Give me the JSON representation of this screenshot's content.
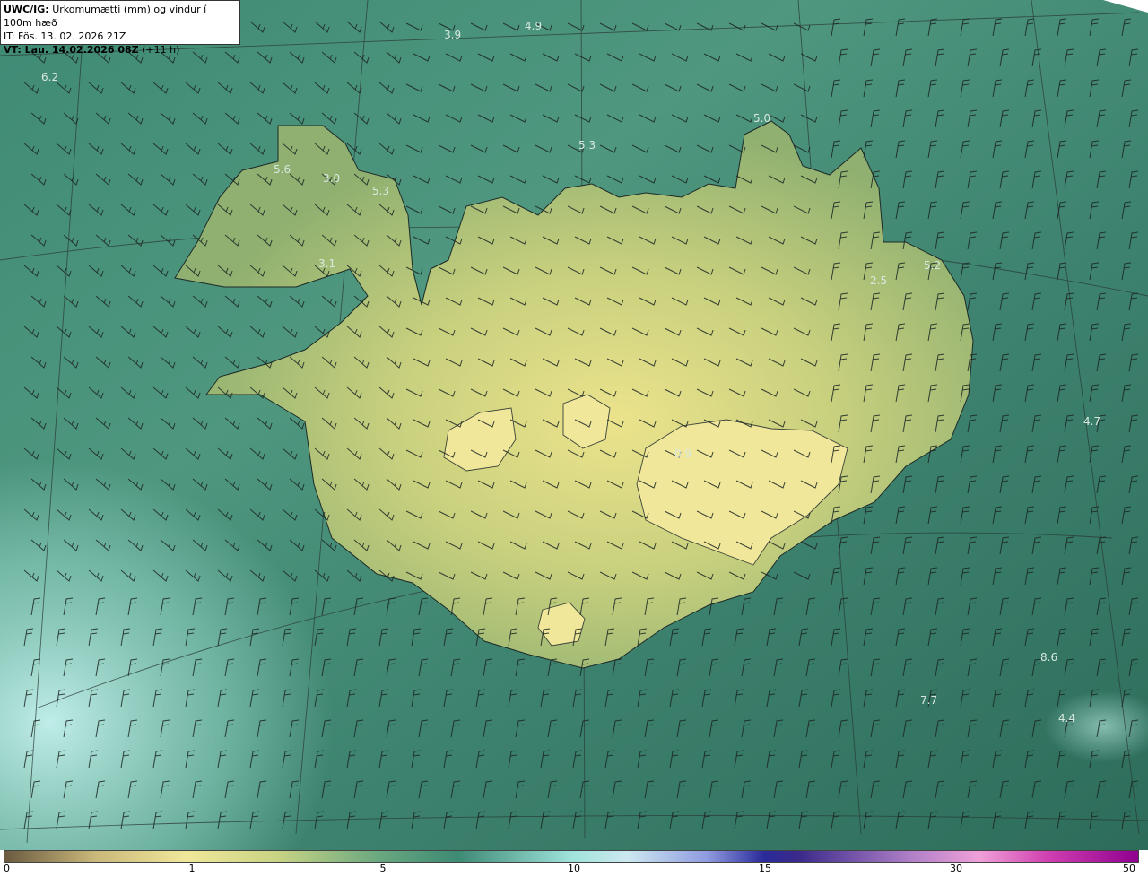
{
  "header": {
    "model": "UWC/IG:",
    "description": "Úrkomumætti (mm) og vindur í 100m hæð",
    "it_label": "IT: Fös. 13. 02. 2026 21Z",
    "vt_prefix": "VT: Lau. 14.02.2026 08Z",
    "vt_suffix": "(+11 h)"
  },
  "colors": {
    "land_low": "#e6e08a",
    "land_mid": "#b4c779",
    "sea_mid": "#5b9a7c",
    "sea_dark": "#2f6e5c",
    "sea_light": "#b7ece6"
  },
  "map_values": [
    {
      "text": "3.9"
    },
    {
      "text": "4.9"
    },
    {
      "text": "6.2"
    },
    {
      "text": "5.0"
    },
    {
      "text": "5.3"
    },
    {
      "text": "5.6"
    },
    {
      "text": "3.0"
    },
    {
      "text": "5.3"
    },
    {
      "text": "3.1"
    },
    {
      "text": "5.2"
    },
    {
      "text": "2.5"
    },
    {
      "text": "4.7"
    },
    {
      "text": "0.9"
    },
    {
      "text": "8.6"
    },
    {
      "text": "7.7"
    },
    {
      "text": "4.4"
    }
  ],
  "colorbar": {
    "ticks": [
      "0",
      "1",
      "5",
      "10",
      "15",
      "30",
      "50"
    ]
  }
}
